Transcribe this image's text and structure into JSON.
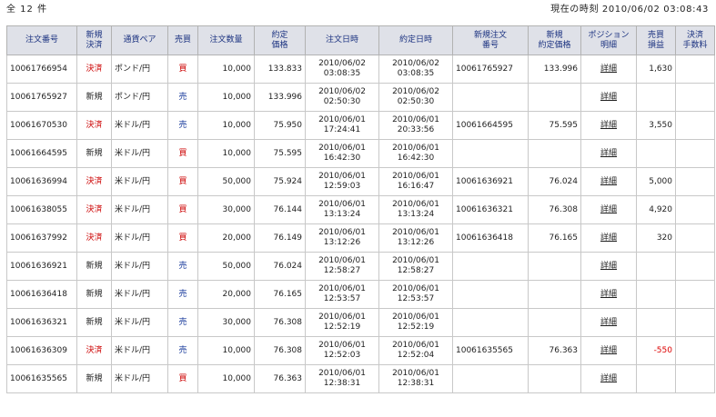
{
  "header": {
    "count_label": "全 12 件",
    "clock_label": "現在の時刻 2010/06/02 03:08:43"
  },
  "columns": {
    "order_no": "注文番号",
    "new_settle_1": "新規",
    "new_settle_2": "決済",
    "pair": "通貨ペア",
    "side": "売買",
    "qty": "注文数量",
    "exec_price_1": "約定",
    "exec_price_2": "価格",
    "order_time": "注文日時",
    "exec_time": "約定日時",
    "new_order_no_1": "新規注文",
    "new_order_no_2": "番号",
    "new_exec_price_1": "新規",
    "new_exec_price_2": "約定価格",
    "position_1": "ポジション",
    "position_2": "明細",
    "pnl_1": "売買",
    "pnl_2": "損益",
    "fee_1": "決済",
    "fee_2": "手数料"
  },
  "rows": [
    {
      "order_no": "10061766954",
      "type": "決済",
      "type_kind": "settle",
      "pair": "ポンド/円",
      "side": "買",
      "side_kind": "buy",
      "qty": "10,000",
      "price": "133.833",
      "order_date": "2010/06/02",
      "order_time": "03:08:35",
      "exec_date": "2010/06/02",
      "exec_time": "03:08:35",
      "new_order_no": "10061765927",
      "new_price": "133.996",
      "detail": "詳細",
      "pnl": "1,630",
      "pnl_kind": "pos",
      "fee": ""
    },
    {
      "order_no": "10061765927",
      "type": "新規",
      "type_kind": "new",
      "pair": "ポンド/円",
      "side": "売",
      "side_kind": "sell",
      "qty": "10,000",
      "price": "133.996",
      "order_date": "2010/06/02",
      "order_time": "02:50:30",
      "exec_date": "2010/06/02",
      "exec_time": "02:50:30",
      "new_order_no": "",
      "new_price": "",
      "detail": "詳細",
      "pnl": "",
      "pnl_kind": "pos",
      "fee": ""
    },
    {
      "order_no": "10061670530",
      "type": "決済",
      "type_kind": "settle",
      "pair": "米ドル/円",
      "side": "売",
      "side_kind": "sell",
      "qty": "10,000",
      "price": "75.950",
      "order_date": "2010/06/01",
      "order_time": "17:24:41",
      "exec_date": "2010/06/01",
      "exec_time": "20:33:56",
      "new_order_no": "10061664595",
      "new_price": "75.595",
      "detail": "詳細",
      "pnl": "3,550",
      "pnl_kind": "pos",
      "fee": ""
    },
    {
      "order_no": "10061664595",
      "type": "新規",
      "type_kind": "new",
      "pair": "米ドル/円",
      "side": "買",
      "side_kind": "buy",
      "qty": "10,000",
      "price": "75.595",
      "order_date": "2010/06/01",
      "order_time": "16:42:30",
      "exec_date": "2010/06/01",
      "exec_time": "16:42:30",
      "new_order_no": "",
      "new_price": "",
      "detail": "詳細",
      "pnl": "",
      "pnl_kind": "pos",
      "fee": ""
    },
    {
      "order_no": "10061636994",
      "type": "決済",
      "type_kind": "settle",
      "pair": "米ドル/円",
      "side": "買",
      "side_kind": "buy",
      "qty": "50,000",
      "price": "75.924",
      "order_date": "2010/06/01",
      "order_time": "12:59:03",
      "exec_date": "2010/06/01",
      "exec_time": "16:16:47",
      "new_order_no": "10061636921",
      "new_price": "76.024",
      "detail": "詳細",
      "pnl": "5,000",
      "pnl_kind": "pos",
      "fee": ""
    },
    {
      "order_no": "10061638055",
      "type": "決済",
      "type_kind": "settle",
      "pair": "米ドル/円",
      "side": "買",
      "side_kind": "buy",
      "qty": "30,000",
      "price": "76.144",
      "order_date": "2010/06/01",
      "order_time": "13:13:24",
      "exec_date": "2010/06/01",
      "exec_time": "13:13:24",
      "new_order_no": "10061636321",
      "new_price": "76.308",
      "detail": "詳細",
      "pnl": "4,920",
      "pnl_kind": "pos",
      "fee": ""
    },
    {
      "order_no": "10061637992",
      "type": "決済",
      "type_kind": "settle",
      "pair": "米ドル/円",
      "side": "買",
      "side_kind": "buy",
      "qty": "20,000",
      "price": "76.149",
      "order_date": "2010/06/01",
      "order_time": "13:12:26",
      "exec_date": "2010/06/01",
      "exec_time": "13:12:26",
      "new_order_no": "10061636418",
      "new_price": "76.165",
      "detail": "詳細",
      "pnl": "320",
      "pnl_kind": "pos",
      "fee": ""
    },
    {
      "order_no": "10061636921",
      "type": "新規",
      "type_kind": "new",
      "pair": "米ドル/円",
      "side": "売",
      "side_kind": "sell",
      "qty": "50,000",
      "price": "76.024",
      "order_date": "2010/06/01",
      "order_time": "12:58:27",
      "exec_date": "2010/06/01",
      "exec_time": "12:58:27",
      "new_order_no": "",
      "new_price": "",
      "detail": "詳細",
      "pnl": "",
      "pnl_kind": "pos",
      "fee": ""
    },
    {
      "order_no": "10061636418",
      "type": "新規",
      "type_kind": "new",
      "pair": "米ドル/円",
      "side": "売",
      "side_kind": "sell",
      "qty": "20,000",
      "price": "76.165",
      "order_date": "2010/06/01",
      "order_time": "12:53:57",
      "exec_date": "2010/06/01",
      "exec_time": "12:53:57",
      "new_order_no": "",
      "new_price": "",
      "detail": "詳細",
      "pnl": "",
      "pnl_kind": "pos",
      "fee": ""
    },
    {
      "order_no": "10061636321",
      "type": "新規",
      "type_kind": "new",
      "pair": "米ドル/円",
      "side": "売",
      "side_kind": "sell",
      "qty": "30,000",
      "price": "76.308",
      "order_date": "2010/06/01",
      "order_time": "12:52:19",
      "exec_date": "2010/06/01",
      "exec_time": "12:52:19",
      "new_order_no": "",
      "new_price": "",
      "detail": "詳細",
      "pnl": "",
      "pnl_kind": "pos",
      "fee": ""
    },
    {
      "order_no": "10061636309",
      "type": "決済",
      "type_kind": "settle",
      "pair": "米ドル/円",
      "side": "売",
      "side_kind": "sell",
      "qty": "10,000",
      "price": "76.308",
      "order_date": "2010/06/01",
      "order_time": "12:52:03",
      "exec_date": "2010/06/01",
      "exec_time": "12:52:04",
      "new_order_no": "10061635565",
      "new_price": "76.363",
      "detail": "詳細",
      "pnl": "-550",
      "pnl_kind": "neg",
      "fee": ""
    },
    {
      "order_no": "10061635565",
      "type": "新規",
      "type_kind": "new",
      "pair": "米ドル/円",
      "side": "買",
      "side_kind": "buy",
      "qty": "10,000",
      "price": "76.363",
      "order_date": "2010/06/01",
      "order_time": "12:38:31",
      "exec_date": "2010/06/01",
      "exec_time": "12:38:31",
      "new_order_no": "",
      "new_price": "",
      "detail": "詳細",
      "pnl": "",
      "pnl_kind": "pos",
      "fee": ""
    }
  ],
  "colors": {
    "header_bg": "#dfe1e8",
    "header_text": "#1b3280",
    "buy": "#cc0000",
    "sell": "#1a3c9c",
    "settle": "#cc0000",
    "negative": "#dd0000"
  }
}
